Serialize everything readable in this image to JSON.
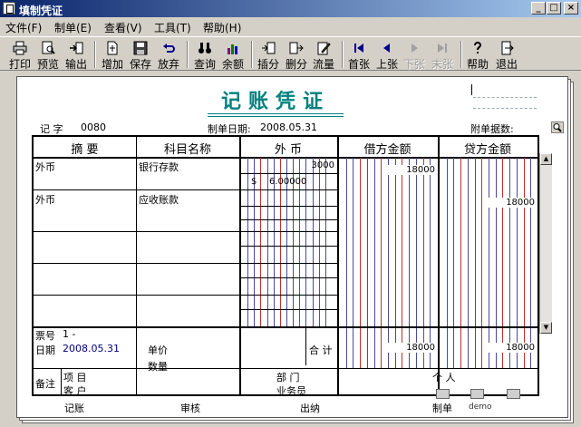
{
  "window": {
    "title": "填制凭证",
    "minimize": "_",
    "maximize": "□",
    "close": "×"
  },
  "menu": [
    "文件(F)",
    "制单(E)",
    "查看(V)",
    "工具(T)",
    "帮助(H)"
  ],
  "toolbar": {
    "print": "打印",
    "preview": "预览",
    "export": "输出",
    "add": "增加",
    "save": "保存",
    "discard": "放弃",
    "query": "查询",
    "balance": "余额",
    "insert": "插分",
    "delete": "删分",
    "flow": "流量",
    "first": "首张",
    "prev": "上张",
    "next": "下张",
    "last": "末张",
    "help": "帮助",
    "exit": "退出"
  },
  "voucher": {
    "title": "记账凭证",
    "type_label": "记 字",
    "number": "0080",
    "date_label": "制单日期:",
    "date": "2008.05.31",
    "attachments_label": "附单据数:",
    "columns": {
      "summary": "摘 要",
      "account": "科目名称",
      "foreign": "外 币",
      "debit": "借方金额",
      "credit": "贷方金额"
    },
    "rows": [
      {
        "summary": "外币",
        "account": "银行存款",
        "fx_amount": "3000",
        "fx_symbol": "$",
        "fx_rate": "6.00000",
        "debit": "18000",
        "credit": ""
      },
      {
        "summary": "外币",
        "account": "应收账款",
        "fx_amount": "",
        "fx_symbol": "",
        "fx_rate": "",
        "debit": "",
        "credit": "18000"
      }
    ],
    "bottom": {
      "ticket_label": "票号",
      "ticket": "1  -",
      "date_label": "日期",
      "date": "2008.05.31",
      "price_label": "单价",
      "qty_label": "数量",
      "total_label": "合 计",
      "total_debit": "18000",
      "total_credit": "18000"
    },
    "notes": {
      "label": "备注",
      "project": "项    目",
      "department": "部    门",
      "person": "个    人",
      "customer": "客    户",
      "salesman": "业务员"
    },
    "signatures": {
      "bookkeeper": "记账",
      "reviewer": "审核",
      "cashier": "出纳",
      "maker_label": "制单",
      "maker": "demo"
    }
  }
}
